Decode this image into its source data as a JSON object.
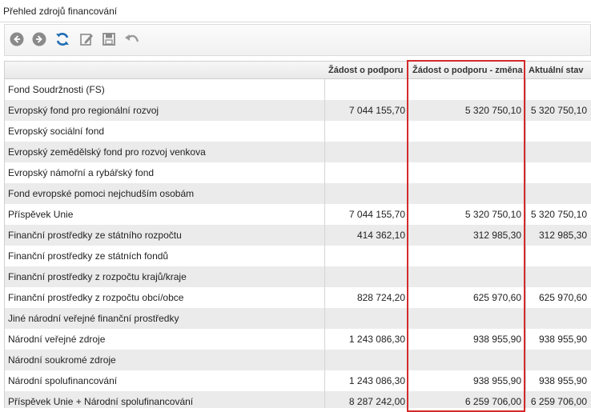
{
  "window": {
    "title": "Přehled zdrojů financování"
  },
  "toolbar": {
    "buttons": [
      {
        "name": "back-button",
        "icon": "arrow-left-icon"
      },
      {
        "name": "forward-button",
        "icon": "arrow-right-icon"
      },
      {
        "name": "refresh-button",
        "icon": "refresh-icon"
      },
      {
        "name": "edit-button",
        "icon": "edit-icon"
      },
      {
        "name": "save-button",
        "icon": "save-icon"
      },
      {
        "name": "undo-button",
        "icon": "undo-icon"
      }
    ]
  },
  "table": {
    "columns": [
      "Žádost o podporu",
      "Žádost o podporu - změna",
      "Aktuální stav"
    ],
    "rows": [
      {
        "label": "Fond Soudržnosti (FS)",
        "values": [
          "",
          "",
          ""
        ]
      },
      {
        "label": "Evropský fond pro regionální rozvoj",
        "values": [
          "7 044 155,70",
          "5 320 750,10",
          "5 320 750,10"
        ]
      },
      {
        "label": "Evropský sociální fond",
        "values": [
          "",
          "",
          ""
        ]
      },
      {
        "label": "Evropský zemědělský fond pro rozvoj venkova",
        "values": [
          "",
          "",
          ""
        ]
      },
      {
        "label": "Evropský námořní a rybářský fond",
        "values": [
          "",
          "",
          ""
        ]
      },
      {
        "label": "Fond evropské pomoci nejchudším osobám",
        "values": [
          "",
          "",
          ""
        ]
      },
      {
        "label": "Příspěvek Unie",
        "values": [
          "7 044 155,70",
          "5 320 750,10",
          "5 320 750,10"
        ]
      },
      {
        "label": "Finanční prostředky ze státního rozpočtu",
        "values": [
          "414 362,10",
          "312 985,30",
          "312 985,30"
        ]
      },
      {
        "label": "Finanční prostředky ze státních fondů",
        "values": [
          "",
          "",
          ""
        ]
      },
      {
        "label": "Finanční prostředky z rozpočtu krajů/kraje",
        "values": [
          "",
          "",
          ""
        ]
      },
      {
        "label": "Finanční prostředky z rozpočtu obcí/obce",
        "values": [
          "828 724,20",
          "625 970,60",
          "625 970,60"
        ]
      },
      {
        "label": "Jiné národní veřejné finanční prostředky",
        "values": [
          "",
          "",
          ""
        ]
      },
      {
        "label": "Národní veřejné zdroje",
        "values": [
          "1 243 086,30",
          "938 955,90",
          "938 955,90"
        ]
      },
      {
        "label": "Národní soukromé zdroje",
        "values": [
          "",
          "",
          ""
        ]
      },
      {
        "label": "Národní spolufinancování",
        "values": [
          "1 243 086,30",
          "938 955,90",
          "938 955,90"
        ]
      },
      {
        "label": "Příspěvek Unie + Národní spolufinancování",
        "values": [
          "8 287 242,00",
          "6 259 706,00",
          "6 259 706,00"
        ]
      }
    ]
  },
  "colors": {
    "highlight": "#d42a2a",
    "alt_row": "#ebebeb"
  }
}
